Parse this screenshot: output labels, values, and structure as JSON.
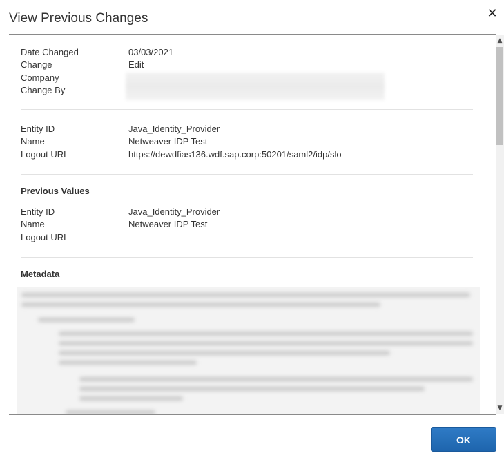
{
  "dialog": {
    "title": "View Previous Changes",
    "close_glyph": "✕",
    "ok_label": "OK"
  },
  "change_info": {
    "rows": [
      {
        "label": "Date Changed",
        "value": "03/03/2021"
      },
      {
        "label": "Change",
        "value": "Edit"
      },
      {
        "label": "Company",
        "value": ""
      },
      {
        "label": "Change By",
        "value": ""
      }
    ]
  },
  "current_values": {
    "rows": [
      {
        "label": "Entity ID",
        "value": "Java_Identity_Provider"
      },
      {
        "label": "Name",
        "value": "Netweaver IDP Test"
      },
      {
        "label": "Logout URL",
        "value": "https://dewdfias136.wdf.sap.corp:50201/saml2/idp/slo"
      }
    ]
  },
  "previous_values": {
    "heading": "Previous Values",
    "rows": [
      {
        "label": "Entity ID",
        "value": "Java_Identity_Provider"
      },
      {
        "label": "Name",
        "value": "Netweaver IDP Test"
      },
      {
        "label": "Logout URL",
        "value": ""
      }
    ]
  },
  "metadata": {
    "heading": "Metadata"
  },
  "scrollbar": {
    "up_glyph": "▲",
    "down_glyph": "▼"
  },
  "colors": {
    "accent": "#1e65ad",
    "title_text": "#333333",
    "divider": "#e2e2e2"
  }
}
